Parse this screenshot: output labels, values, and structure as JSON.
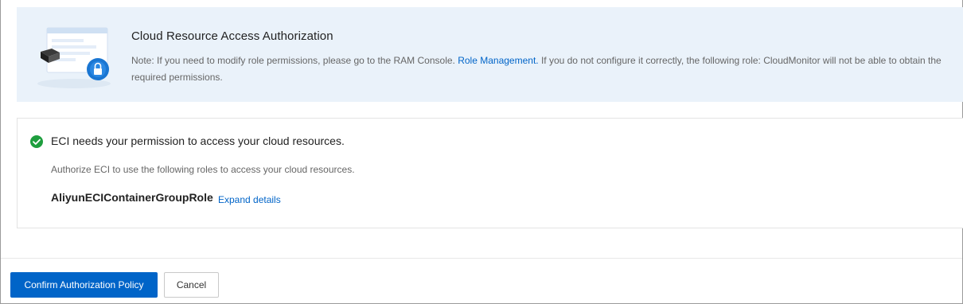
{
  "banner": {
    "title": "Cloud Resource Access Authorization",
    "note_prefix": "Note: If you need to modify role permissions, please go to the RAM Console.",
    "note_link": "Role Management.",
    "note_suffix": "If you do not configure it correctly, the following role: CloudMonitor will not be able to obtain the required permissions.",
    "illustration_icon": "server-lock-illustration"
  },
  "permission": {
    "icon": "check-circle-icon",
    "title": "ECI needs your permission to access your cloud resources.",
    "description": "Authorize ECI to use the following roles to access your cloud resources.",
    "role_name": "AliyunECIContainerGroupRole",
    "expand_label": "Expand details"
  },
  "footer": {
    "confirm_label": "Confirm Authorization Policy",
    "cancel_label": "Cancel"
  },
  "colors": {
    "accent": "#0064c8",
    "success": "#1e9e3e",
    "banner_bg": "#eaf2fa"
  }
}
